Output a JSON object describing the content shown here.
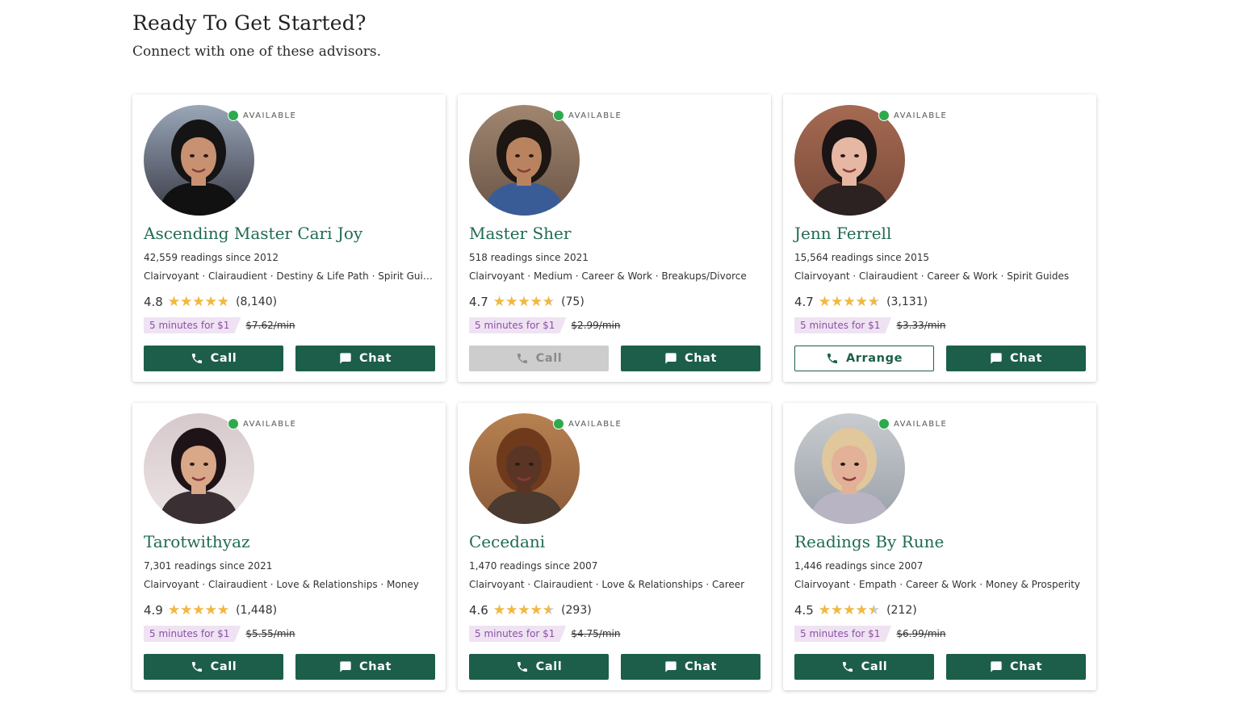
{
  "heading": "Ready To Get Started?",
  "subheading": "Connect with one of these advisors.",
  "colors": {
    "brand_green": "#1c5e4a",
    "name_green": "#1f6b53",
    "star": "#f4b83b",
    "available": "#2eaa4c",
    "promo_bg": "#efe3f3",
    "promo_text": "#8d4fa6"
  },
  "advisors": [
    {
      "status": "AVAILABLE",
      "name": "Ascending Master Cari Joy",
      "readings": "42,559 readings since 2012",
      "specialties": "Clairvoyant · Clairaudient · Destiny & Life Path · Spirit Guides",
      "rating": "4.8",
      "rating_fraction": 0.96,
      "reviews": "(8,140)",
      "promo": "5 minutes for $1",
      "old_price": "$7.62/min",
      "primary_action": {
        "label": "Call",
        "icon": "phone-icon",
        "state": "enabled"
      },
      "chat": {
        "label": "Chat",
        "icon": "chat-icon"
      }
    },
    {
      "status": "AVAILABLE",
      "name": "Master Sher",
      "readings": "518 readings since 2021",
      "specialties": "Clairvoyant · Medium · Career & Work · Breakups/Divorce",
      "rating": "4.7",
      "rating_fraction": 0.94,
      "reviews": "(75)",
      "promo": "5 minutes for $1",
      "old_price": "$2.99/min",
      "primary_action": {
        "label": "Call",
        "icon": "phone-icon",
        "state": "disabled"
      },
      "chat": {
        "label": "Chat",
        "icon": "chat-icon"
      }
    },
    {
      "status": "AVAILABLE",
      "name": "Jenn Ferrell",
      "readings": "15,564 readings since 2015",
      "specialties": "Clairvoyant · Clairaudient · Career & Work · Spirit Guides",
      "rating": "4.7",
      "rating_fraction": 0.94,
      "reviews": "(3,131)",
      "promo": "5 minutes for $1",
      "old_price": "$3.33/min",
      "primary_action": {
        "label": "Arrange",
        "icon": "phone-icon",
        "state": "outline"
      },
      "chat": {
        "label": "Chat",
        "icon": "chat-icon"
      }
    },
    {
      "status": "AVAILABLE",
      "name": "Tarotwithyaz",
      "readings": "7,301 readings since 2021",
      "specialties": "Clairvoyant · Clairaudient · Love & Relationships · Money",
      "rating": "4.9",
      "rating_fraction": 0.98,
      "reviews": "(1,448)",
      "promo": "5 minutes for $1",
      "old_price": "$5.55/min",
      "primary_action": {
        "label": "Call",
        "icon": "phone-icon",
        "state": "enabled"
      },
      "chat": {
        "label": "Chat",
        "icon": "chat-icon"
      }
    },
    {
      "status": "AVAILABLE",
      "name": "Cecedani",
      "readings": "1,470 readings since 2007",
      "specialties": "Clairvoyant · Clairaudient · Love & Relationships · Career",
      "rating": "4.6",
      "rating_fraction": 0.92,
      "reviews": "(293)",
      "promo": "5 minutes for $1",
      "old_price": "$4.75/min",
      "primary_action": {
        "label": "Call",
        "icon": "phone-icon",
        "state": "enabled"
      },
      "chat": {
        "label": "Chat",
        "icon": "chat-icon"
      }
    },
    {
      "status": "AVAILABLE",
      "name": "Readings By Rune",
      "readings": "1,446 readings since 2007",
      "specialties": "Clairvoyant · Empath · Career & Work · Money & Prosperity",
      "rating": "4.5",
      "rating_fraction": 0.9,
      "reviews": "(212)",
      "promo": "5 minutes for $1",
      "old_price": "$6.99/min",
      "primary_action": {
        "label": "Call",
        "icon": "phone-icon",
        "state": "enabled"
      },
      "chat": {
        "label": "Chat",
        "icon": "chat-icon"
      }
    }
  ]
}
